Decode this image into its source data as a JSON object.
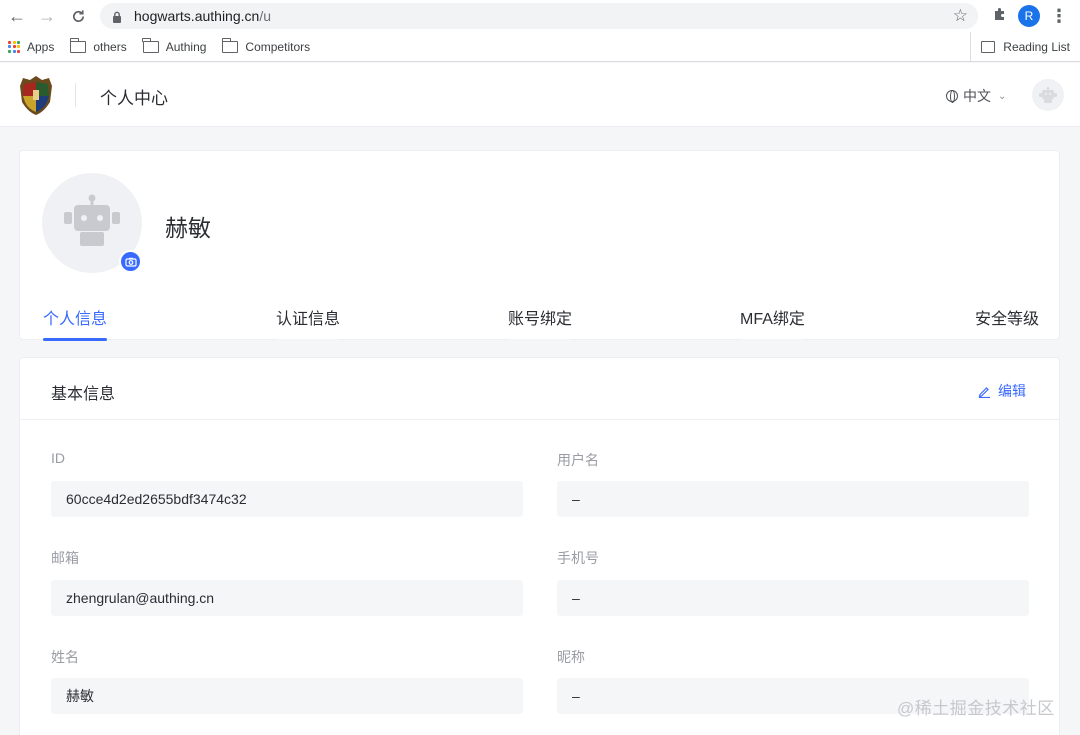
{
  "browser": {
    "url_host": "hogwarts.authing.cn",
    "url_path": "/u",
    "profile_initial": "R",
    "bookmarks": [
      {
        "label": "Apps"
      },
      {
        "label": "others"
      },
      {
        "label": "Authing"
      },
      {
        "label": "Competitors"
      }
    ],
    "reading_list_label": "Reading List"
  },
  "header": {
    "title": "个人中心",
    "language": "中文"
  },
  "profile": {
    "name": "赫敏",
    "tabs": [
      {
        "label": "个人信息",
        "active": true
      },
      {
        "label": "认证信息",
        "active": false
      },
      {
        "label": "账号绑定",
        "active": false
      },
      {
        "label": "MFA绑定",
        "active": false
      },
      {
        "label": "安全等级",
        "active": false
      }
    ]
  },
  "basic_info": {
    "title": "基本信息",
    "edit_label": "编辑",
    "fields": [
      {
        "label": "ID",
        "value": "60cce4d2ed2655bdf3474c32"
      },
      {
        "label": "用户名",
        "value": "–"
      },
      {
        "label": "邮箱",
        "value": "zhengrulan@authing.cn"
      },
      {
        "label": "手机号",
        "value": "–"
      },
      {
        "label": "姓名",
        "value": "赫敏"
      },
      {
        "label": "昵称",
        "value": "–"
      }
    ]
  },
  "watermark": "@稀土掘金技术社区",
  "colors": {
    "accent": "#396aff",
    "page_bg": "#f5f6f8",
    "card_bg": "#ffffff",
    "muted_label": "#9a9ca4"
  }
}
